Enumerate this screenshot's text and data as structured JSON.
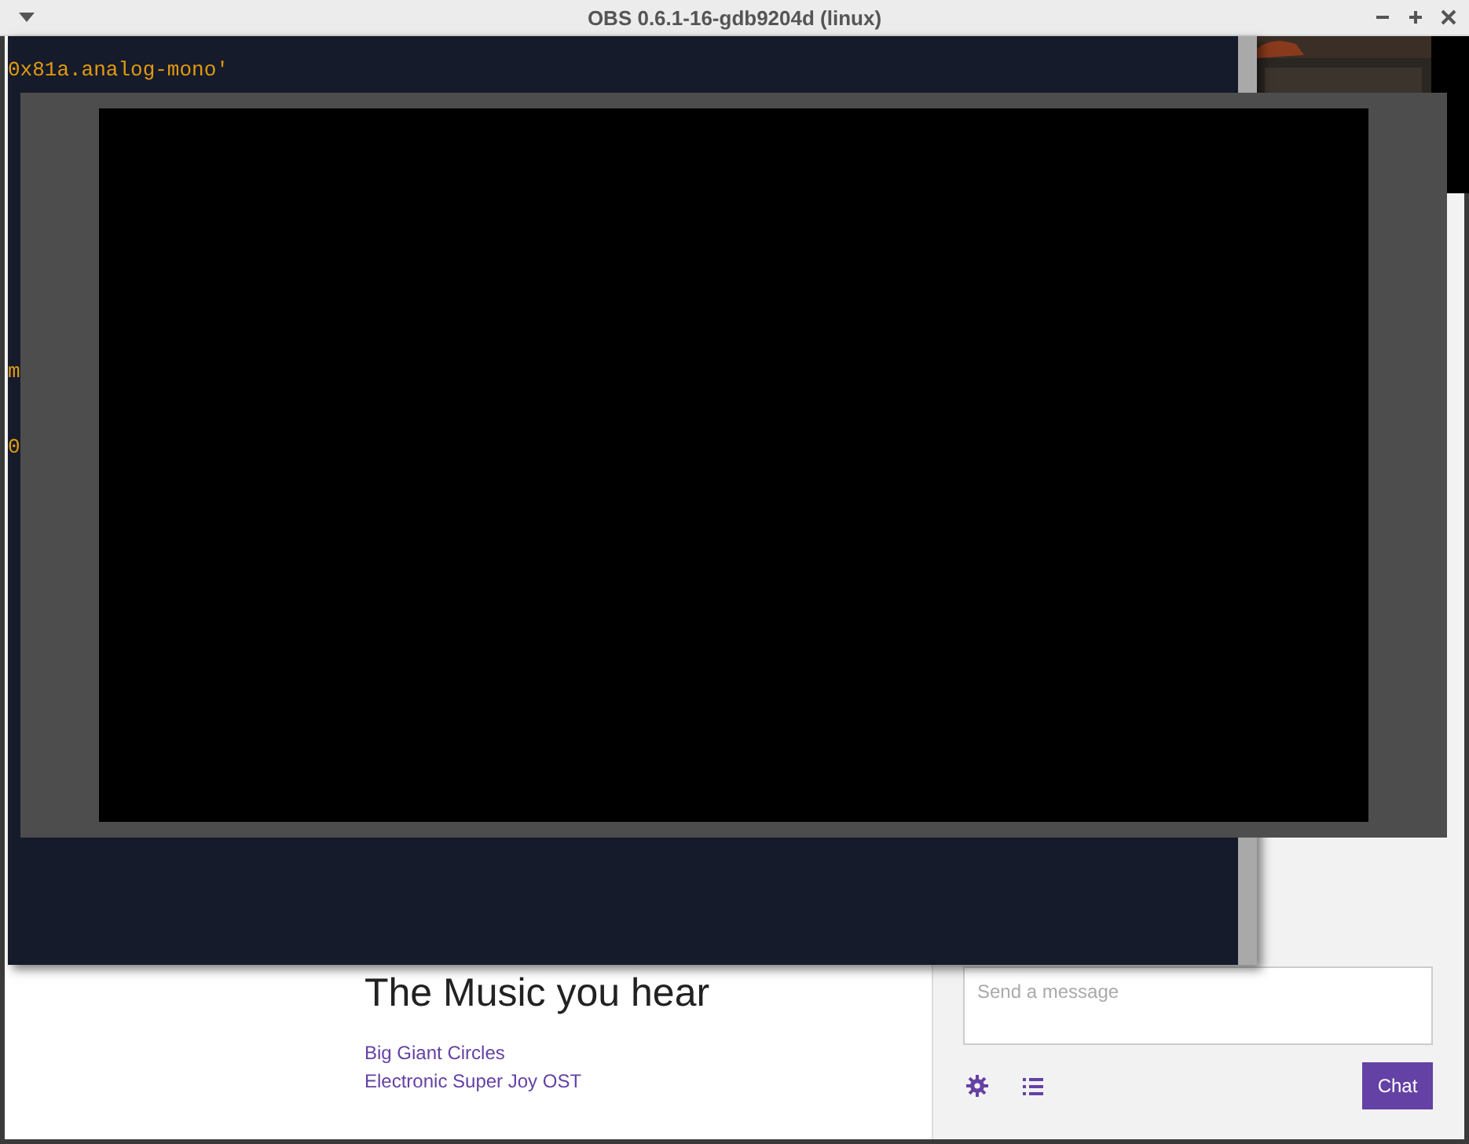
{
  "window": {
    "title": "OBS 0.6.1-16-gdb9204d (linux)"
  },
  "terminal": {
    "lines": [
      "0x81a.analog-mono'",
      "m",
      "0"
    ]
  },
  "page": {
    "heading": "The Music you hear",
    "links": [
      "Big Giant Circles",
      "Electronic Super Joy OST"
    ]
  },
  "chat": {
    "placeholder": "Send a message",
    "button": "Chat"
  }
}
